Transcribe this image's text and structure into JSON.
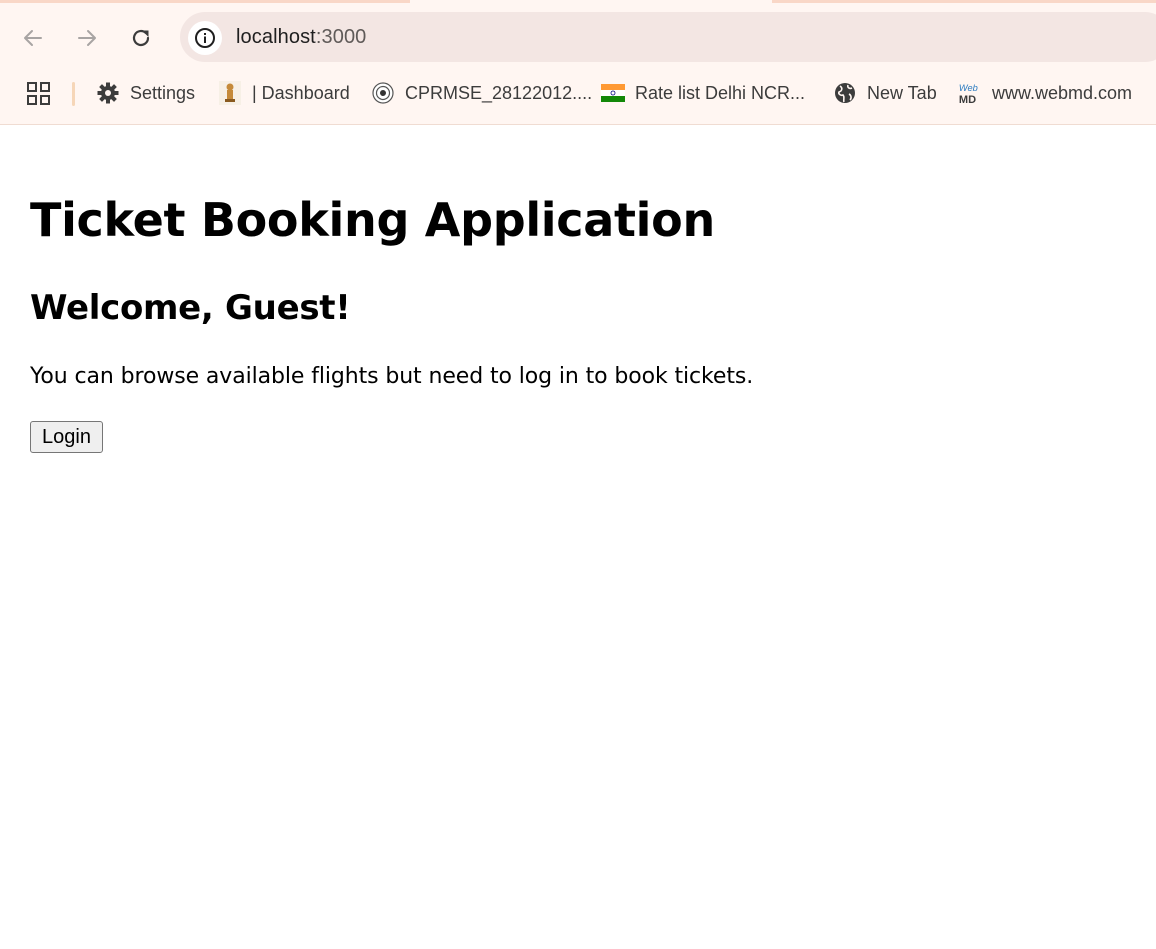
{
  "browser": {
    "url_host": "localhost",
    "url_port": ":3000",
    "icons": {
      "back": "arrow-left-icon",
      "forward": "arrow-right-icon",
      "reload": "reload-icon",
      "site_info": "info-icon",
      "apps": "apps-grid-icon"
    },
    "bookmarks": [
      {
        "label": "Settings",
        "icon": "gear-icon"
      },
      {
        "label": "| Dashboard",
        "icon": "emblem-icon"
      },
      {
        "label": "CPRMSE_28122012....",
        "icon": "seal-icon"
      },
      {
        "label": "Rate list Delhi NCR...",
        "icon": "india-flag-icon"
      },
      {
        "label": "New Tab",
        "icon": "globe-icon"
      },
      {
        "label": "www.webmd.com",
        "icon": "webmd-logo-icon"
      }
    ],
    "colors": {
      "toolbar_bg": "#fff6f2",
      "omnibox_bg": "#f3e6e3",
      "tabstrip": "#f9d7c7"
    }
  },
  "page": {
    "title": "Ticket Booking Application",
    "welcome": "Welcome, Guest!",
    "message": "You can browse available flights but need to log in to book tickets.",
    "login_button": "Login"
  }
}
